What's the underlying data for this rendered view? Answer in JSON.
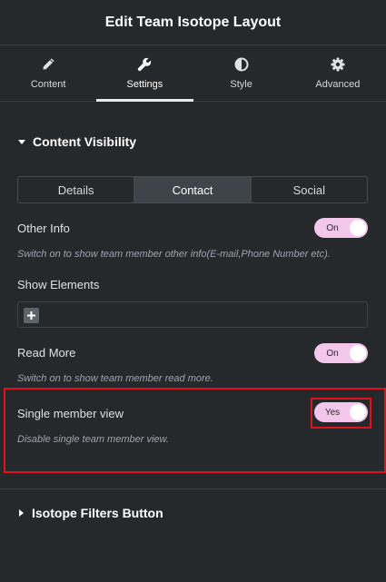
{
  "header": {
    "title": "Edit Team Isotope Layout"
  },
  "tabs": [
    {
      "label": "Content",
      "icon": "pencil-icon"
    },
    {
      "label": "Settings",
      "icon": "wrench-icon",
      "active": true
    },
    {
      "label": "Style",
      "icon": "half-circle-icon"
    },
    {
      "label": "Advanced",
      "icon": "gear-icon"
    }
  ],
  "section_content_visibility": {
    "title": "Content Visibility",
    "segments": [
      "Details",
      "Contact",
      "Social"
    ],
    "active_segment": "Contact"
  },
  "other_info": {
    "label": "Other Info",
    "toggle": "On",
    "description": "Switch on to show team member other info(E-mail,Phone Number etc)."
  },
  "show_elements": {
    "label": "Show Elements"
  },
  "read_more": {
    "label": "Read More",
    "toggle": "On",
    "description": "Switch on to show team member read more."
  },
  "single_member_view": {
    "label": "Single member view",
    "toggle": "Yes",
    "description": "Disable single team member view."
  },
  "section_isotope_filters": {
    "title": "Isotope Filters Button"
  },
  "colors": {
    "background": "#26292c",
    "toggle_on": "#f3c6ec",
    "highlight": "#e0101e",
    "active_segment": "#3f444b"
  }
}
